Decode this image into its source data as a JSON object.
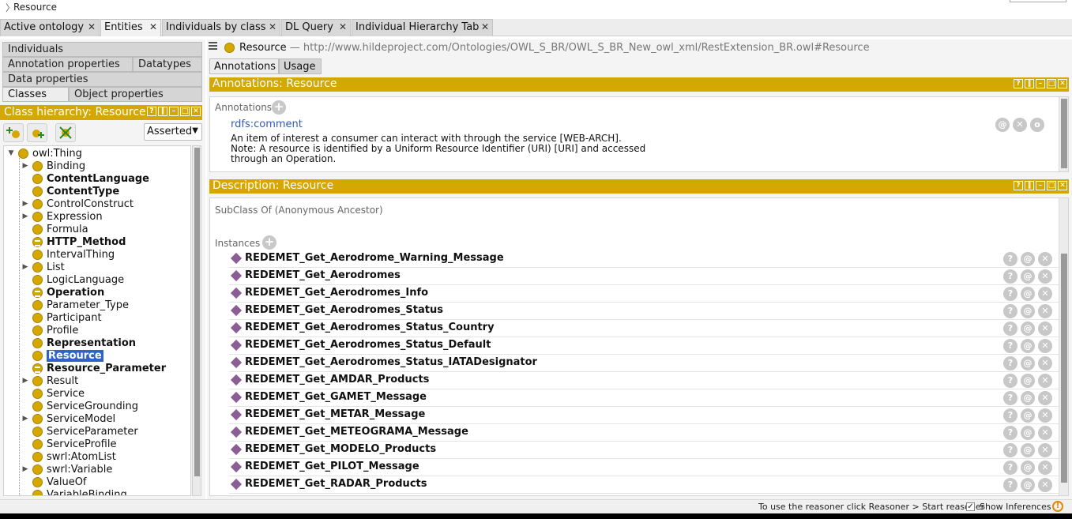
{
  "breadcrumb": {
    "text": "Resource"
  },
  "top_tabs": [
    {
      "label": "Active ontology",
      "active": false
    },
    {
      "label": "Entities",
      "active": true
    },
    {
      "label": "Individuals by class",
      "active": false
    },
    {
      "label": "DL Query",
      "active": false
    },
    {
      "label": "Individual Hierarchy Tab",
      "active": false
    }
  ],
  "left_tabs": {
    "individuals": "Individuals",
    "annotation_properties": "Annotation properties",
    "datatypes": "Datatypes",
    "data_properties": "Data properties",
    "classes": "Classes",
    "object_properties": "Object properties"
  },
  "class_hierarchy": {
    "title": "Class hierarchy: Resource",
    "mode": "Asserted",
    "root": "owl:Thing",
    "items": [
      {
        "label": "Binding",
        "bold": false,
        "expand": true,
        "eq": false
      },
      {
        "label": "ContentLanguage",
        "bold": true,
        "expand": false,
        "eq": false
      },
      {
        "label": "ContentType",
        "bold": true,
        "expand": false,
        "eq": false
      },
      {
        "label": "ControlConstruct",
        "bold": false,
        "expand": true,
        "eq": false
      },
      {
        "label": "Expression",
        "bold": false,
        "expand": true,
        "eq": false
      },
      {
        "label": "Formula",
        "bold": false,
        "expand": false,
        "eq": false
      },
      {
        "label": "HTTP_Method",
        "bold": true,
        "expand": false,
        "eq": true
      },
      {
        "label": "IntervalThing",
        "bold": false,
        "expand": false,
        "eq": false
      },
      {
        "label": "List",
        "bold": false,
        "expand": true,
        "eq": false
      },
      {
        "label": "LogicLanguage",
        "bold": false,
        "expand": false,
        "eq": false
      },
      {
        "label": "Operation",
        "bold": true,
        "expand": false,
        "eq": true
      },
      {
        "label": "Parameter_Type",
        "bold": false,
        "expand": false,
        "eq": false
      },
      {
        "label": "Participant",
        "bold": false,
        "expand": false,
        "eq": false
      },
      {
        "label": "Profile",
        "bold": false,
        "expand": false,
        "eq": false
      },
      {
        "label": "Representation",
        "bold": true,
        "expand": false,
        "eq": false
      },
      {
        "label": "Resource",
        "bold": true,
        "expand": false,
        "eq": false,
        "selected": true
      },
      {
        "label": "Resource_Parameter",
        "bold": true,
        "expand": false,
        "eq": true
      },
      {
        "label": "Result",
        "bold": false,
        "expand": true,
        "eq": false
      },
      {
        "label": "Service",
        "bold": false,
        "expand": false,
        "eq": false
      },
      {
        "label": "ServiceGrounding",
        "bold": false,
        "expand": false,
        "eq": false
      },
      {
        "label": "ServiceModel",
        "bold": false,
        "expand": true,
        "eq": false
      },
      {
        "label": "ServiceParameter",
        "bold": false,
        "expand": false,
        "eq": false
      },
      {
        "label": "ServiceProfile",
        "bold": false,
        "expand": false,
        "eq": false
      },
      {
        "label": "swrl:AtomList",
        "bold": false,
        "expand": false,
        "eq": false
      },
      {
        "label": "swrl:Variable",
        "bold": false,
        "expand": true,
        "eq": false
      },
      {
        "label": "ValueOf",
        "bold": false,
        "expand": false,
        "eq": false
      },
      {
        "label": "VariableBinding",
        "bold": false,
        "expand": false,
        "eq": false
      }
    ]
  },
  "entity_header": {
    "name": "Resource",
    "separator": " — ",
    "iri": "http://www.hildeproject.com/Ontologies/OWL_S_BR/OWL_S_BR_New_owl_xml/RestExtension_BR.owl#Resource"
  },
  "right_tabs": {
    "annotations": "Annotations",
    "usage": "Usage"
  },
  "annotations_section": {
    "title": "Annotations: Resource",
    "label": "Annotations",
    "property": "rdfs:comment",
    "value": "An item of interest a consumer can interact with through the service [WEB-ARCH].\nNote: A resource is identified by a Uniform Resource Identifier (URI) [URI] and accessed\nthrough an Operation."
  },
  "description_section": {
    "title": "Description: Resource",
    "subclass_label": "SubClass Of (Anonymous Ancestor)",
    "instances_label": "Instances",
    "instances": [
      "REDEMET_Get_Aerodrome_Warning_Message",
      "REDEMET_Get_Aerodromes",
      "REDEMET_Get_Aerodromes_Info",
      "REDEMET_Get_Aerodromes_Status",
      "REDEMET_Get_Aerodromes_Status_Country",
      "REDEMET_Get_Aerodromes_Status_Default",
      "REDEMET_Get_Aerodromes_Status_IATADesignator",
      "REDEMET_Get_AMDAR_Products",
      "REDEMET_Get_GAMET_Message",
      "REDEMET_Get_METAR_Message",
      "REDEMET_Get_METEOGRAMA_Message",
      "REDEMET_Get_MODELO_Products",
      "REDEMET_Get_PILOT_Message",
      "REDEMET_Get_RADAR_Products"
    ]
  },
  "icons": {
    "help": "?",
    "at": "@",
    "delete": "✕",
    "options": "o",
    "add": "+",
    "close_tab": "✕"
  },
  "status_bar": {
    "message": "To use the reasoner click Reasoner > Start reasoner",
    "checkbox_label": "Show Inferences",
    "checked": true,
    "warning_icon": "!"
  },
  "colors": {
    "accent": "#d4a800",
    "individual": "#8b5e93",
    "selection": "#2f63c8"
  }
}
